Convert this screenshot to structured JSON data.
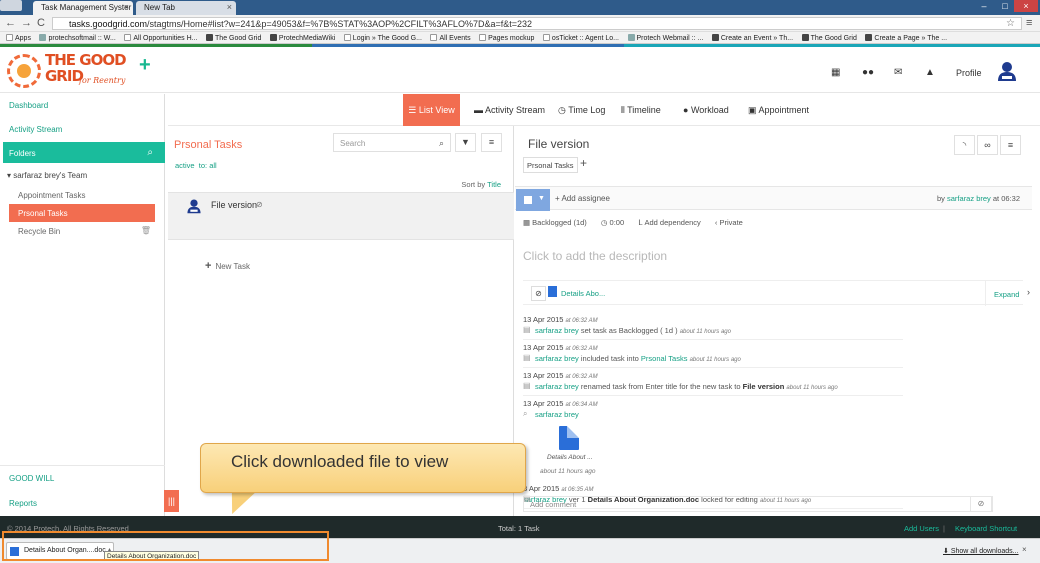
{
  "browser": {
    "tabs": [
      {
        "label": "Task Management Syster"
      },
      {
        "label": "New Tab"
      }
    ],
    "url_host": "tasks.goodgrid.com",
    "url_path": "/stagtms/Home#list?w=241&p=49053&f=%7B%STAT%3AOP%2CFILT%3AFLO%7D&a=f&t=232",
    "bookmarks": [
      {
        "label": "Apps",
        "icon": "grid-icon"
      },
      {
        "label": "protechsoftmail :: W...",
        "icon": "globe-icon"
      },
      {
        "label": "All Opportunities H...",
        "icon": "page-icon"
      },
      {
        "label": "The Good Grid",
        "icon": "pf-icon"
      },
      {
        "label": "ProtechMediaWiki",
        "icon": "pf-icon"
      },
      {
        "label": "Login » The Good G...",
        "icon": "page-icon"
      },
      {
        "label": "All Events",
        "icon": "page-icon"
      },
      {
        "label": "Pages mockup",
        "icon": "page-icon"
      },
      {
        "label": "osTicket :: Agent Lo...",
        "icon": "page-icon"
      },
      {
        "label": "Protech Webmail :: ...",
        "icon": "globe-icon"
      },
      {
        "label": "Create an Event » Th...",
        "icon": "pf-icon"
      },
      {
        "label": "The Good Grid",
        "icon": "pf-icon"
      },
      {
        "label": "Create a Page » The ...",
        "icon": "pf-icon"
      }
    ]
  },
  "header": {
    "logo_line1": "THE GOOD",
    "logo_line2": "GRID",
    "logo_sub": "for Reentry",
    "profile_label": "Profile"
  },
  "sidebar": {
    "dashboard": "Dashboard",
    "activity_stream": "Activity Stream",
    "folders_label": "Folders",
    "team_header": "sarfaraz brey's Team",
    "items": [
      {
        "label": "Appointment Tasks"
      },
      {
        "label": "Prsonal Tasks"
      },
      {
        "label": "Recycle Bin"
      }
    ],
    "good_will": "GOOD WILL",
    "reports": "Reports"
  },
  "views": {
    "list": "List View",
    "activity": "Activity Stream",
    "timelog": "Time Log",
    "timeline": "Timeline",
    "workload": "Workload",
    "appointment": "Appointment"
  },
  "tasklist": {
    "title": "Prsonal Tasks",
    "search_placeholder": "Search",
    "filter_active": "active",
    "filter_to": "to: all",
    "sort_label": "Sort by",
    "sort_value": "Title",
    "task_name": "File version",
    "new_task": "New Task"
  },
  "detail": {
    "title": "File version",
    "folder_chip": "Prsonal Tasks",
    "add_assignee": "Add assignee",
    "by_prefix": "by",
    "by_user": "sarfaraz brey",
    "by_time": "at 06:32",
    "status": "Backlogged (1d)",
    "time": "0:00",
    "dependency": "Add dependency",
    "privacy": "Private",
    "description_placeholder": "Click to add the description",
    "attachment_name": "Details Abo...",
    "expand": "Expand",
    "comment_placeholder": "Add comment"
  },
  "activity": [
    {
      "date": "13 Apr 2015",
      "time": "at 06:32 AM",
      "user": "sarfaraz brey",
      "text": "set task as Backlogged ( 1d )",
      "ago": "about 11 hours ago"
    },
    {
      "date": "13 Apr 2015",
      "time": "at 06:32 AM",
      "user": "sarfaraz brey",
      "text": "included task into",
      "target": "Prsonal Tasks",
      "ago": "about 11 hours ago"
    },
    {
      "date": "13 Apr 2015",
      "time": "at 06:32 AM",
      "user": "sarfaraz brey",
      "text": "renamed task from Enter title for the new task to",
      "bold": "File version",
      "ago": "about 11 hours ago"
    },
    {
      "date": "13 Apr 2015",
      "time": "at 06:34 AM",
      "user": "sarfaraz brey",
      "file_name": "Details About ...",
      "file_ago": "about 11 hours ago"
    },
    {
      "date": "3 Apr 2015",
      "time": "at 06:35 AM",
      "user": "sarfaraz brey",
      "text": "ver 1",
      "bold": "Details About Organization.doc",
      "text2": "locked for editing",
      "ago": "about 11 hours ago"
    }
  ],
  "callout": {
    "text": "Click downloaded file to view"
  },
  "footer": {
    "copyright": "© 2014 Protech, All Rights Reserved",
    "total": "Total: 1 Task",
    "add_users": "Add Users",
    "separator": "|",
    "keyboard": "Keyboard Shortcut"
  },
  "downloads": {
    "item": "Details About Organ....doc",
    "tooltip": "Details About Organization.doc",
    "show_all": "Show all downloads..."
  },
  "colors": {
    "accent_teal": "#1abc9c",
    "accent_orange": "#f26d50",
    "link": "#16a085"
  }
}
